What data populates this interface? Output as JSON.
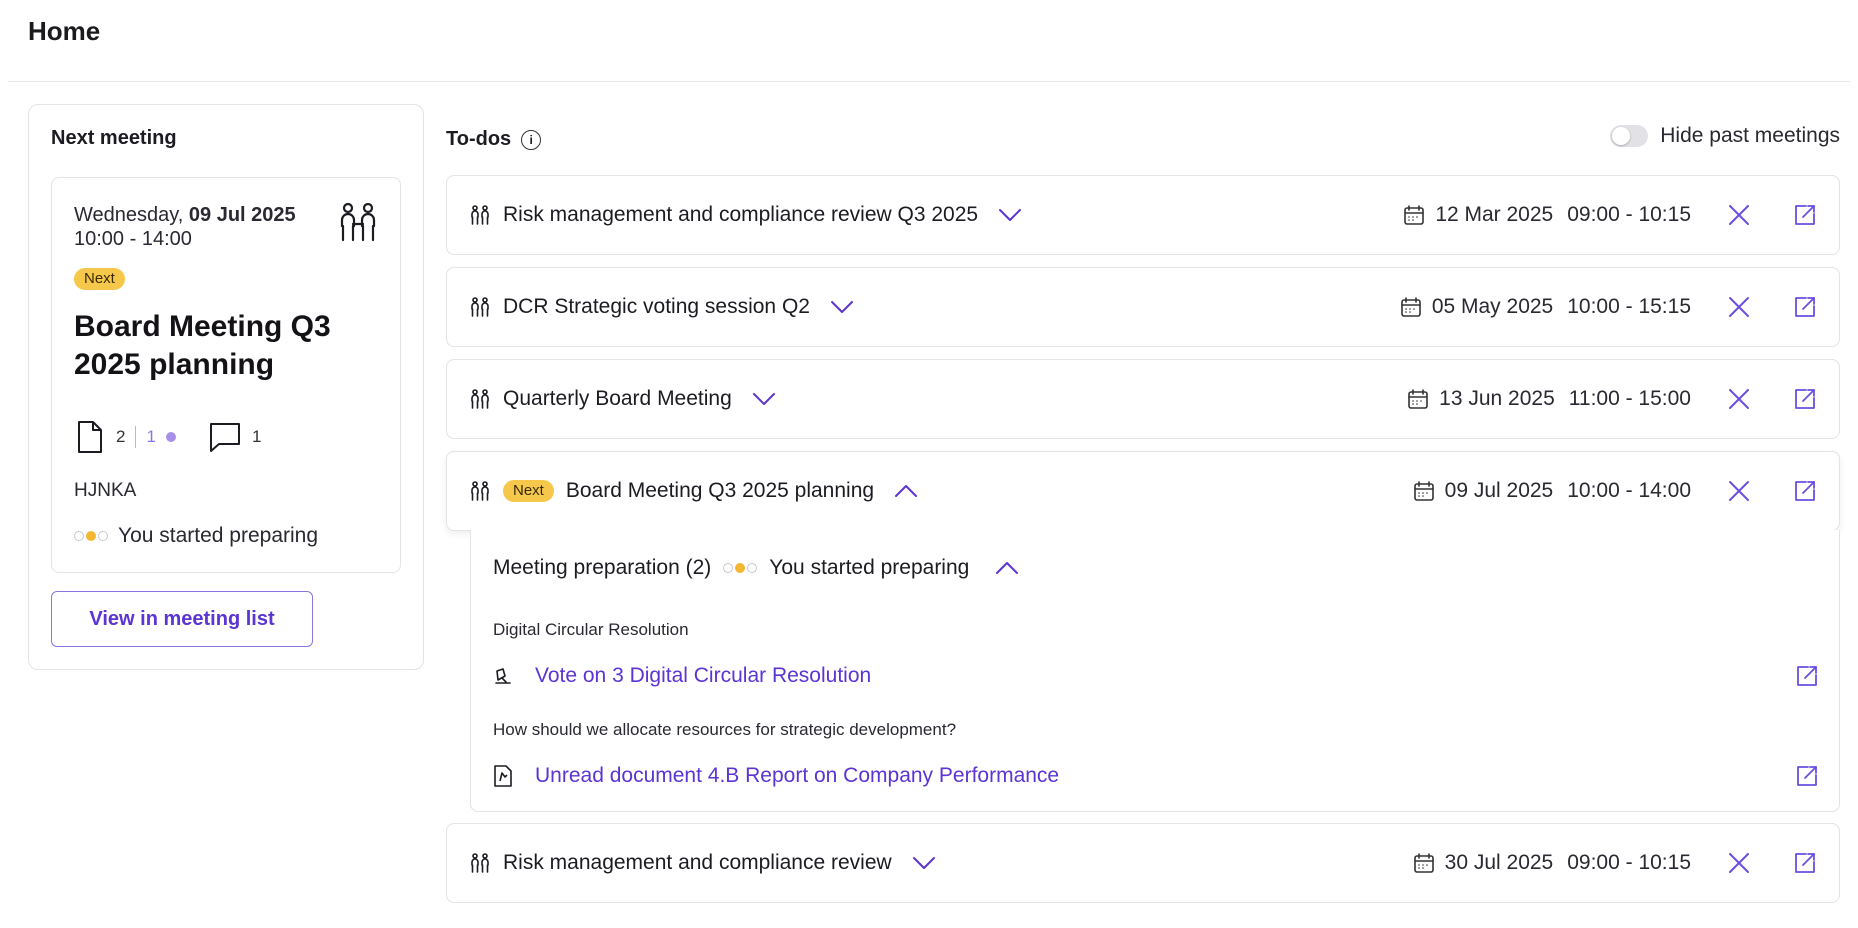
{
  "page": {
    "title": "Home"
  },
  "next_meeting": {
    "heading": "Next meeting",
    "weekday": "Wednesday, ",
    "date": "09 Jul 2025",
    "time": "10:00 - 14:00",
    "badge": "Next",
    "title": "Board Meeting Q3 2025 planning",
    "docs_count": "2",
    "docs_unread": "1",
    "comments_count": "1",
    "org": "HJNKA",
    "prep_status": "You started preparing",
    "prep_dots": [
      false,
      true,
      false
    ],
    "view_button": "View in meeting list"
  },
  "todos": {
    "title": "To-dos",
    "toggle_label": "Hide past meetings",
    "toggle_on": false
  },
  "meetings": [
    {
      "title": "Risk management and compliance review Q3 2025",
      "date": "12 Mar 2025",
      "time": "09:00 - 10:15"
    },
    {
      "title": "DCR Strategic voting session Q2",
      "date": "05 May 2025",
      "time": "10:00 - 15:15"
    },
    {
      "title": "Quarterly Board Meeting",
      "date": "13 Jun 2025",
      "time": "11:00 - 15:00"
    },
    {
      "title": "Board Meeting Q3 2025 planning",
      "badge": "Next",
      "date": "09 Jul 2025",
      "time": "10:00 - 14:00"
    },
    {
      "title": "Risk management and compliance review",
      "date": "30 Jul 2025",
      "time": "09:00 - 10:15"
    }
  ],
  "preparation": {
    "title": "Meeting preparation (2)",
    "status": "You started preparing",
    "dots": [
      false,
      true,
      false
    ],
    "sections": [
      {
        "label": "Digital Circular Resolution",
        "item": "Vote on 3 Digital Circular Resolution"
      },
      {
        "label": "How should we allocate resources for strategic development?",
        "item": "Unread document 4.B Report on Company Performance"
      }
    ]
  },
  "colors": {
    "accent": "#5b34d3",
    "badge": "#f5c84c",
    "dot_active": "#f5b730"
  },
  "icons": {
    "meeting": "people-icon",
    "calendar": "calendar-icon",
    "close": "close-icon",
    "external": "external-link-icon",
    "vote": "vote-icon",
    "document": "document-icon",
    "comment": "comment-icon"
  }
}
